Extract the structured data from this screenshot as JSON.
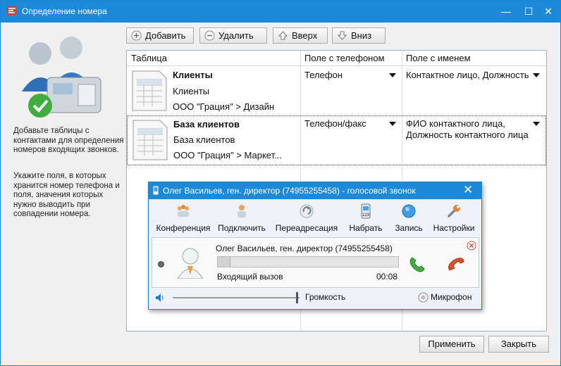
{
  "window": {
    "title": "Определение номера"
  },
  "sidebar": {
    "hint1": "Добавьте таблицы с контактами для определения номеров входящих звонков.",
    "hint2": "Укажите поля, в которых хранится номер телефона и поля, значения которых нужно выводить при совпадении номера."
  },
  "toolbar": {
    "add": "Добавить",
    "delete": "Удалить",
    "up": "Вверх",
    "down": "Вниз"
  },
  "table": {
    "columns": [
      "Таблица",
      "Поле  с телефоном",
      "Поле с именем"
    ],
    "rows": [
      {
        "title": "Клиенты",
        "subtitle": "Клиенты",
        "path": "ООО \"Грация\" > Дизайн",
        "phone_field": "Телефон",
        "name_field": "Контактное лицо, Должность"
      },
      {
        "title": "База клиентов",
        "subtitle": "База клиентов",
        "path": "ООО \"Грация\" > Маркет...",
        "phone_field": "Телефон/факс",
        "name_field": "ФИО контактного лица, Должность контактного лица"
      }
    ]
  },
  "call_popup": {
    "title": "Олег Васильев, ген. директор (74955255458) - голосовой звонок",
    "tools": [
      "Конференция",
      "Подключить",
      "Переадресация",
      "Набрать",
      "Запись",
      "Настройки"
    ],
    "caller": "Олег Васильев, ген. директор (74955255458)",
    "status": "Входящий вызов",
    "timer": "00:08",
    "progress": 0.07,
    "volume_label": "Громкость",
    "volume_level": 0.97,
    "mic_label": "Микрофон"
  },
  "footer": {
    "apply": "Применить",
    "close": "Закрыть"
  }
}
